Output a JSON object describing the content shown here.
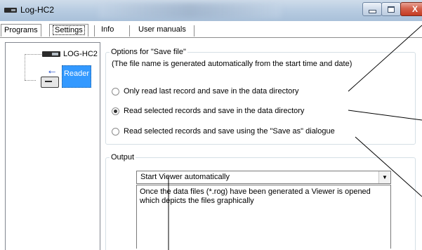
{
  "window": {
    "title": "Log-HC2",
    "close_glyph": "X"
  },
  "menu": {
    "programs_label": "Programs",
    "settings_label": "Settings",
    "info_label": "Info",
    "manuals_label": "User manuals"
  },
  "tree": {
    "root_label": "LOG-HC2",
    "reader_label": "Reader"
  },
  "save_group": {
    "legend": "Options for \"Save file\"",
    "note": "(The file name is generated automatically from the  start time and date)",
    "options": [
      {
        "label": "Only read last record and save in the data directory",
        "checked": false
      },
      {
        "label": "Read selected records and save in the data directory",
        "checked": true
      },
      {
        "label": "Read selected records and save using the \"Save as\" dialogue",
        "checked": false
      }
    ]
  },
  "output_group": {
    "legend": "Output",
    "selected": "Start Viewer automatically",
    "description": "Once the data files (*.rog) have been generated a Viewer is opened which depicts the files graphically"
  },
  "icons": {
    "app": "device-icon",
    "reader": "reader-icon",
    "dropdown": "chevron-down-icon"
  },
  "colors": {
    "selection": "#3399ff",
    "close_button": "#c43b22"
  }
}
